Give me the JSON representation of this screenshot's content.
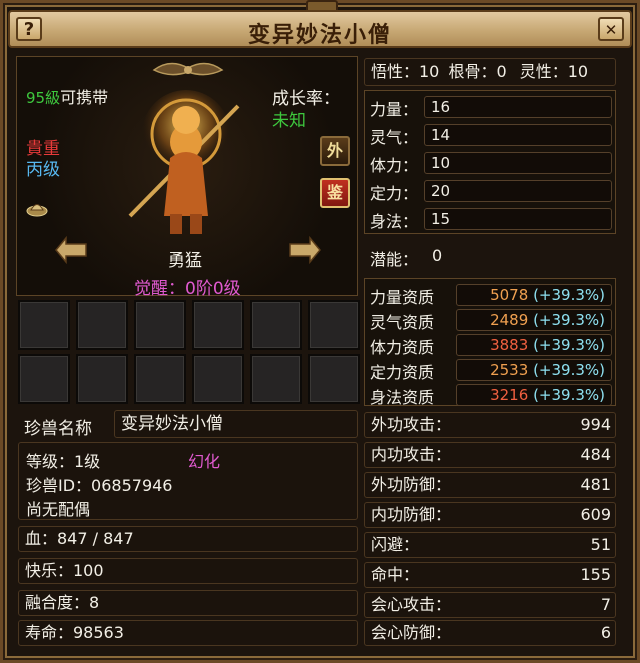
{
  "title": "变异妙法小僧",
  "help_button": "?",
  "close_button": "✕",
  "pet": {
    "level_number": "95級",
    "carry_label": "可携带",
    "growth_label": "成长率：",
    "growth_value": "未知",
    "rarity": "貴重",
    "grade": "丙级",
    "btn_external": "外",
    "btn_appraise": "鉴",
    "trait": "勇猛",
    "awaken": "觉醒：0阶0级",
    "name_label": "珍兽名称",
    "name_value": "变异妙法小僧",
    "level_line": "等级：1级",
    "transform": "幻化",
    "id_line": "珍兽ID：06857946",
    "spouse": "尚无配偶",
    "hp": "血：847 / 847",
    "happiness": "快乐：100",
    "fusion": "融合度：8",
    "lifespan": "寿命：98563"
  },
  "top_stats": {
    "wuxing": "悟性：10",
    "gengu": "根骨：0",
    "lingxing": "灵性：10"
  },
  "attributes": [
    {
      "label": "力量：",
      "value": "16"
    },
    {
      "label": "灵气：",
      "value": "14"
    },
    {
      "label": "体力：",
      "value": "10"
    },
    {
      "label": "定力：",
      "value": "20"
    },
    {
      "label": "身法：",
      "value": "15"
    }
  ],
  "potential": {
    "label": "潜能：",
    "value": "0"
  },
  "aptitudes": [
    {
      "label": "力量资质",
      "value": "5078",
      "bonus": "(+39.3%)",
      "color": "#f0a050"
    },
    {
      "label": "灵气资质",
      "value": "2489",
      "bonus": "(+39.3%)",
      "color": "#f0a050"
    },
    {
      "label": "体力资质",
      "value": "3883",
      "bonus": "(+39.3%)",
      "color": "#f06040"
    },
    {
      "label": "定力资质",
      "value": "2533",
      "bonus": "(+39.3%)",
      "color": "#f0a050"
    },
    {
      "label": "身法资质",
      "value": "3216",
      "bonus": "(+39.3%)",
      "color": "#f06040"
    }
  ],
  "combat": [
    {
      "label": "外功攻击：",
      "value": "994"
    },
    {
      "label": "内功攻击：",
      "value": "484"
    },
    {
      "label": "外功防御：",
      "value": "481"
    },
    {
      "label": "内功防御：",
      "value": "609"
    },
    {
      "label": "闪避：",
      "value": "51"
    },
    {
      "label": "命中：",
      "value": "155"
    },
    {
      "label": "会心攻击：",
      "value": "7"
    },
    {
      "label": "会心防御：",
      "value": "6"
    }
  ],
  "colors": {
    "level_green": "#3ec83e",
    "growth_green": "#3ec83e",
    "rarity_red": "#e83a3a",
    "grade_blue": "#58b8f0",
    "awaken_magenta": "#e05ad0",
    "transform_magenta": "#e05ad0",
    "bonus_cyan": "#8ee0f0"
  }
}
